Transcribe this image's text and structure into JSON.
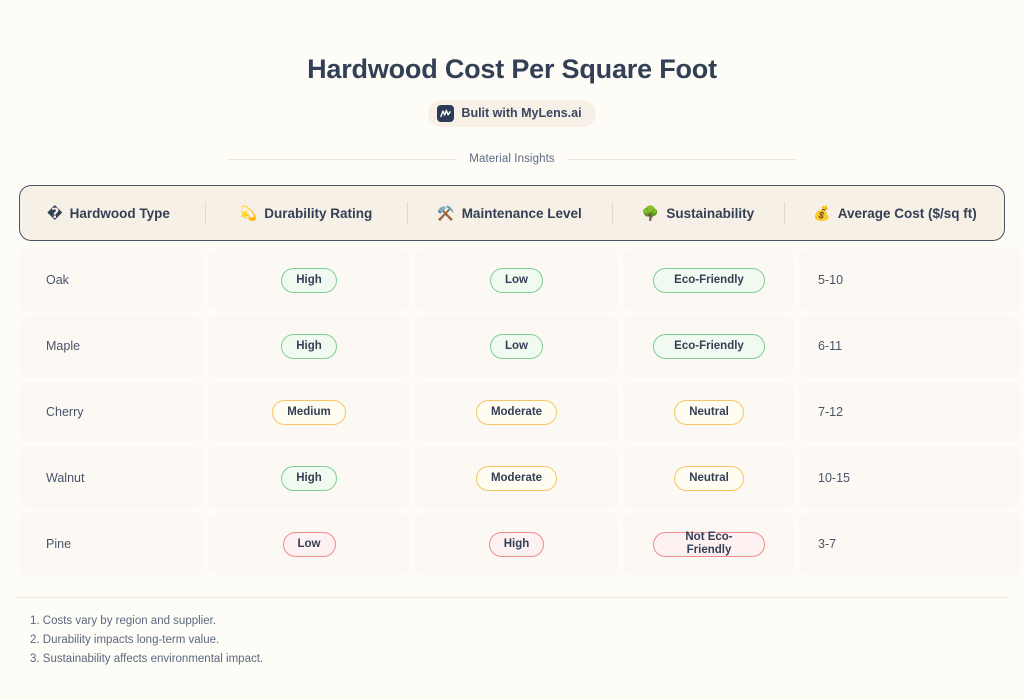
{
  "header": {
    "title": "Hardwood Cost Per Square Foot",
    "badge_text": "Bulit with MyLens.ai",
    "badge_icon": "mylens-logo-icon",
    "section_label": "Material Insights"
  },
  "table": {
    "columns": [
      {
        "emoji": "�",
        "emoji_name": "missing-glyph-icon",
        "label": "Hardwood Type"
      },
      {
        "emoji": "💫",
        "emoji_name": "sparkle-star-icon",
        "label": "Durability Rating"
      },
      {
        "emoji": "⚒️",
        "emoji_name": "hammer-and-pick-icon",
        "label": "Maintenance Level"
      },
      {
        "emoji": "🌳",
        "emoji_name": "tree-icon",
        "label": "Sustainability"
      },
      {
        "emoji": "💰",
        "emoji_name": "money-bag-icon",
        "label": "Average Cost ($/sq ft)"
      }
    ],
    "rows": [
      {
        "name": "Oak",
        "durability": {
          "text": "High",
          "tone": "green"
        },
        "maintenance": {
          "text": "Low",
          "tone": "green"
        },
        "sustainability": {
          "text": "Eco-Friendly",
          "tone": "green",
          "wrap": true
        },
        "cost": "5-10"
      },
      {
        "name": "Maple",
        "durability": {
          "text": "High",
          "tone": "green"
        },
        "maintenance": {
          "text": "Low",
          "tone": "green"
        },
        "sustainability": {
          "text": "Eco-Friendly",
          "tone": "green",
          "wrap": true
        },
        "cost": "6-11"
      },
      {
        "name": "Cherry",
        "durability": {
          "text": "Medium",
          "tone": "amber"
        },
        "maintenance": {
          "text": "Moderate",
          "tone": "amber"
        },
        "sustainability": {
          "text": "Neutral",
          "tone": "amber",
          "wrap": false
        },
        "cost": "7-12"
      },
      {
        "name": "Walnut",
        "durability": {
          "text": "High",
          "tone": "green"
        },
        "maintenance": {
          "text": "Moderate",
          "tone": "amber"
        },
        "sustainability": {
          "text": "Neutral",
          "tone": "amber",
          "wrap": false
        },
        "cost": "10-15"
      },
      {
        "name": "Pine",
        "durability": {
          "text": "Low",
          "tone": "red"
        },
        "maintenance": {
          "text": "High",
          "tone": "red"
        },
        "sustainability": {
          "text": "Not Eco-Friendly",
          "tone": "red",
          "wrap": true
        },
        "cost": "3-7"
      }
    ]
  },
  "footer": {
    "notes": [
      "1. Costs vary by region and supplier.",
      "2. Durability impacts long-term value.",
      "3. Sustainability affects environmental impact."
    ]
  },
  "colors": {
    "page_background": "#FEFCF6",
    "header_background": "#F7F0E6",
    "header_border": "#4A5468",
    "cell_background": "#FCF9F4",
    "text_dark": "#333F55",
    "text_muted": "#5B687F",
    "green": "#7FCF91",
    "amber": "#F6C664",
    "red": "#F08C8C"
  }
}
